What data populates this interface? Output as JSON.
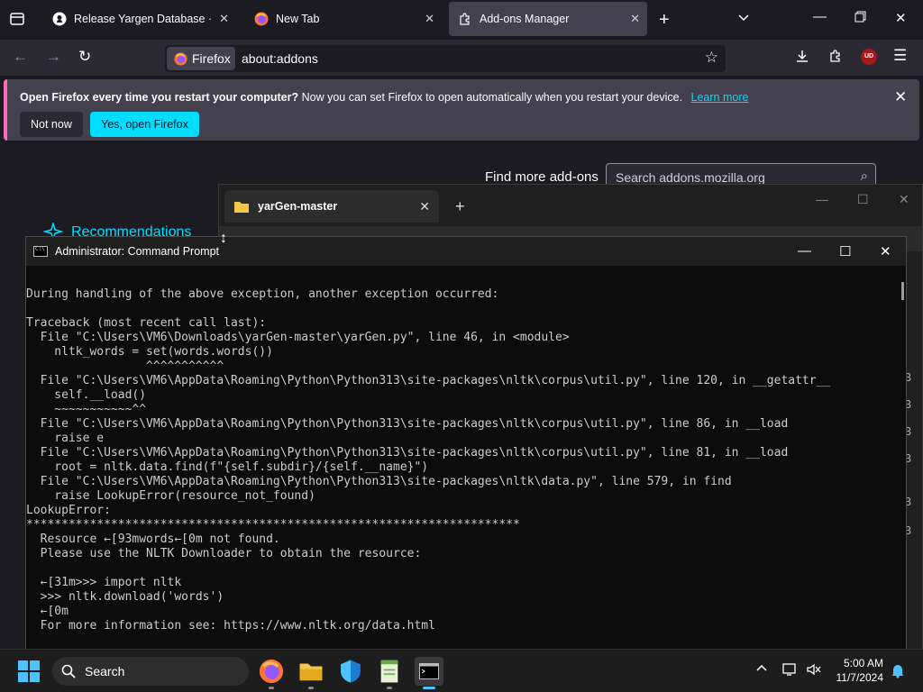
{
  "firefox": {
    "tabs": [
      {
        "label": "Release Yargen Database · Hydr"
      },
      {
        "label": "New Tab"
      },
      {
        "label": "Add-ons Manager"
      }
    ],
    "url": {
      "identity": "Firefox",
      "text": "about:addons"
    },
    "notification": {
      "bold": "Open Firefox every time you restart your computer?",
      "message": "Now you can set Firefox to open automatically when you restart your device.",
      "link": "Learn more",
      "secondary_button": "Not now",
      "primary_button": "Yes, open Firefox"
    },
    "addons": {
      "find_more": "Find more add-ons",
      "search_placeholder": "Search addons.mozilla.org",
      "recommendations": "Recommendations"
    },
    "profile_badge": "UD"
  },
  "explorer": {
    "tab_label": "yarGen-master",
    "side_numbers": [
      "3",
      "3",
      "3",
      "3",
      "3",
      "3"
    ]
  },
  "cmd": {
    "title": "Administrator: Command Prompt",
    "lines": [
      "",
      "During handling of the above exception, another exception occurred:",
      "",
      "Traceback (most recent call last):",
      "  File \"C:\\Users\\VM6\\Downloads\\yarGen-master\\yarGen.py\", line 46, in <module>",
      "    nltk_words = set(words.words())",
      "                 ^^^^^^^^^^^",
      "  File \"C:\\Users\\VM6\\AppData\\Roaming\\Python\\Python313\\site-packages\\nltk\\corpus\\util.py\", line 120, in __getattr__",
      "    self.__load()",
      "    ~~~~~~~~~~~^^",
      "  File \"C:\\Users\\VM6\\AppData\\Roaming\\Python\\Python313\\site-packages\\nltk\\corpus\\util.py\", line 86, in __load",
      "    raise e",
      "  File \"C:\\Users\\VM6\\AppData\\Roaming\\Python\\Python313\\site-packages\\nltk\\corpus\\util.py\", line 81, in __load",
      "    root = nltk.data.find(f\"{self.subdir}/{self.__name}\")",
      "  File \"C:\\Users\\VM6\\AppData\\Roaming\\Python\\Python313\\site-packages\\nltk\\data.py\", line 579, in find",
      "    raise LookupError(resource_not_found)",
      "LookupError:",
      "**********************************************************************",
      "  Resource ←[93mwords←[0m not found.",
      "  Please use the NLTK Downloader to obtain the resource:",
      "",
      "  ←[31m>>> import nltk",
      "  >>> nltk.download('words')",
      "  ←[0m",
      "  For more information see: https://www.nltk.org/data.html"
    ]
  },
  "taskbar": {
    "search_label": "Search",
    "time": "5:00 AM",
    "date": "11/7/2024"
  },
  "colors": {
    "accent": "#00ddff",
    "windows_accent": "#4cc2ff"
  }
}
